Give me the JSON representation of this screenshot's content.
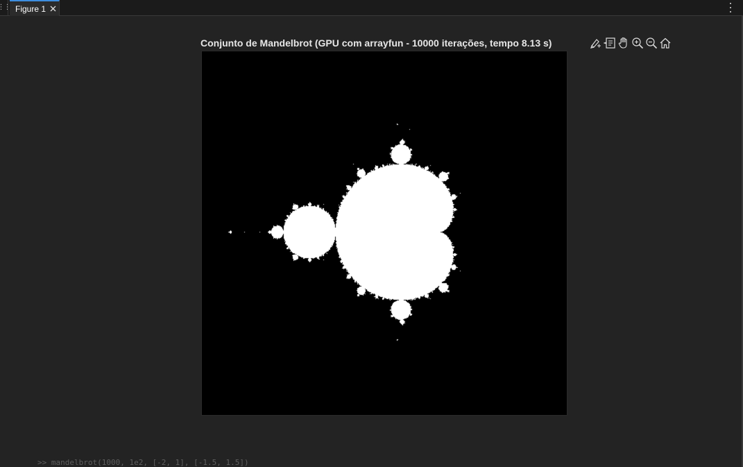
{
  "window": {
    "tab": {
      "label": "Figure 1",
      "close_icon": "close-icon"
    },
    "menu_icon": "kebab-menu-icon",
    "grip_icon": "panel-grip-icon"
  },
  "figure": {
    "title": "Conjunto de Mandelbrot (GPU com arrayfun - 10000 iterações, tempo 8.13 s)",
    "image": {
      "colormap": [
        "#000000",
        "#ffffff"
      ]
    },
    "toolbar": [
      {
        "name": "brush-tool",
        "icon": "brush-icon"
      },
      {
        "name": "data-tips-tool",
        "icon": "datatip-icon"
      },
      {
        "name": "pan-tool",
        "icon": "hand-icon"
      },
      {
        "name": "zoom-in-tool",
        "icon": "zoom-in-icon"
      },
      {
        "name": "zoom-out-icon-tool",
        "icon": "zoom-out-icon"
      },
      {
        "name": "restore-view-tool",
        "icon": "home-icon"
      }
    ]
  },
  "background_text": ">> mandelbrot(1000, 1e2, [-2, 1], [-1.5, 1.5])",
  "colors": {
    "tab_accent": "#3d8ee0",
    "background": "#232323",
    "plot_bg": "#000000",
    "set_color": "#ffffff"
  }
}
